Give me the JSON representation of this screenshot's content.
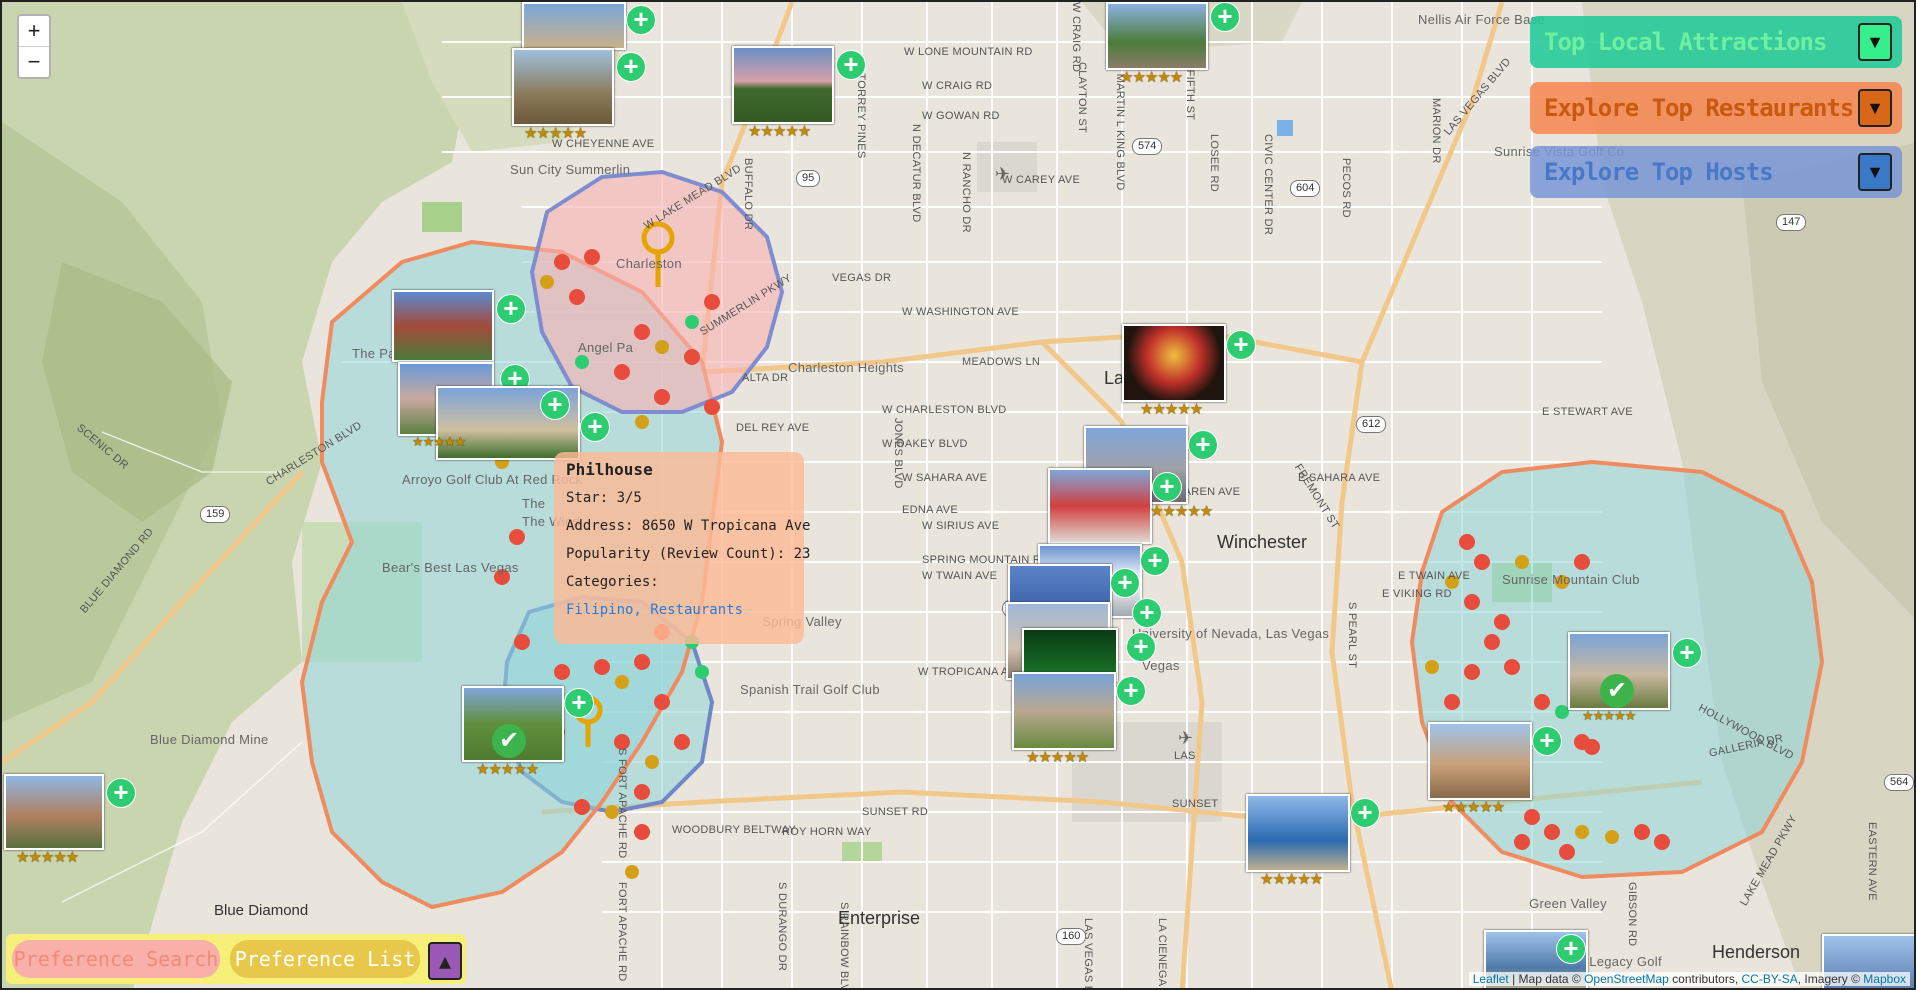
{
  "zoom": {
    "in_label": "+",
    "out_label": "−"
  },
  "panels": {
    "attractions": {
      "label": "Top Local Attractions",
      "toggle": "▼",
      "color": "#20c997"
    },
    "restaurants": {
      "label": "Explore Top Restaurants",
      "toggle": "▼",
      "color": "#f58a55"
    },
    "hosts": {
      "label": "Explore Top Hosts",
      "toggle": "▼",
      "color": "#6b8fd6"
    }
  },
  "popup": {
    "title": "Philhouse",
    "star": "Star: 3/5",
    "address": "Address: 8650 W Tropicana Ave",
    "popularity": "Popularity (Review Count): 23",
    "categories_label": "Categories:",
    "categories": "Filipino, Restaurants"
  },
  "bottom": {
    "search_label": "Preference Search ✓",
    "list_label": "Preference List",
    "toggle": "▲"
  },
  "attribution": {
    "leaflet": "Leaflet",
    "text1": " | Map data © ",
    "osm": "OpenStreetMap",
    "text2": " contributors, ",
    "ccbysa": "CC-BY-SA",
    "text3": ", Imagery © ",
    "mapbox": "Mapbox"
  },
  "places": [
    "Winchester",
    "Enterprise",
    "Henderson",
    "Charleston Heights",
    "Spring Valley",
    "Sun City Summerlin",
    "Blue Diamond",
    "Blue Diamond Mine",
    "Bear's Best Las Vegas",
    "Arroyo Golf Club At Red Rock",
    "University of Nevada, Las Vegas",
    "Spanish Trail Golf Club",
    "Nellis Air Force Base",
    "Sunrise Vista Golf Co",
    "Green Valley",
    "The Legacy Golf",
    "Sunrise Mountain Club",
    "Las",
    "The",
    "Angel Pa",
    "The Pa",
    "The Wind",
    "Charleston",
    "Vegas",
    "LAS"
  ],
  "streets": [
    "W LONE MOUNTAIN RD",
    "W CRAIG RD",
    "W GOWAN RD",
    "W CHEYENNE AVE",
    "W CAREY AVE",
    "VEGAS DR",
    "W WASHINGTON AVE",
    "MEADOWS LN",
    "ALTA DR",
    "W CHARLESTON BLVD",
    "W OAKEY BLVD",
    "W SAHARA AVE",
    "EDNA AVE",
    "W SIRIUS AVE",
    "SPRING MOUNTAIN RD",
    "W TWAIN AVE",
    "W TROPICANA AVE",
    "SUNSET RD",
    "ROY HORN WAY",
    "E SAHARA AVE",
    "E STEWART AVE",
    "KAREN AVE",
    "E TWAIN AVE",
    "E VIKING RD",
    "DEL REY AVE",
    "W LAKE MEAD BLVD",
    "SUMMERLIN PKWY",
    "CHARLESTON BLVD",
    "BLUE DIAMOND RD",
    "SCENIC DR",
    "LAS VEGAS BLVD",
    "N MARTIN L KING BLVD",
    "N DECATUR BLVD",
    "N RANCHO DR",
    "CLAYTON ST",
    "N FIFTH ST",
    "CIVIC CENTER DR",
    "PECOS RD",
    "MARION DR",
    "LOSEE RD",
    "S PEARL ST",
    "FREMONT ST",
    "BUFFALO DR",
    "W CRAIG RD",
    "JONES BLVD",
    "S RAINBOW BLVD",
    "S DURANGO DR",
    "EASTERN AVE",
    "FORT APACHE RD",
    "GIBSON RD",
    "LAKE MEAD PKWY",
    "HOLLYWOOD BLVD",
    "GALLERIA DR",
    "S FORT APACHE RD",
    "WOODBURY BELTWAY",
    "N TORREY PINES",
    "LAS VEGAS BLVD S",
    "SUNSET",
    "LA CIENEGA ST"
  ],
  "shields": [
    "574",
    "95",
    "604",
    "612",
    "147",
    "159",
    "592",
    "160",
    "564"
  ],
  "rating_stars": "★★★★★"
}
